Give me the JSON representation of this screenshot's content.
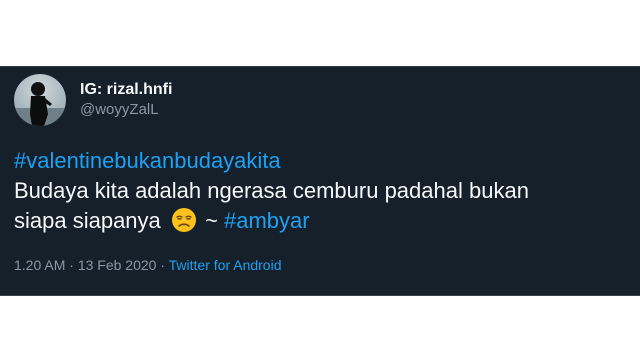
{
  "tweet": {
    "author": {
      "display_name": "IG: rizal.hnfi",
      "handle": "@woyyZalL"
    },
    "text": {
      "hashtag_1": "#valentinebukanbudayakita",
      "line_1": "Budaya kita adalah ngerasa cemburu padahal bukan",
      "line_2": "siapa siapanya",
      "tilde": " ~ ",
      "hashtag_2": "#ambyar"
    },
    "emoji": "unamused-face-emoji",
    "meta": {
      "time": "1.20 AM",
      "separator": " · ",
      "date": "13 Feb 2020",
      "separator_2": " · ",
      "source": "Twitter for Android"
    }
  },
  "colors": {
    "background": "#15202b",
    "text": "#f5f8fa",
    "muted": "#8899a6",
    "accent": "#1da1f2"
  }
}
